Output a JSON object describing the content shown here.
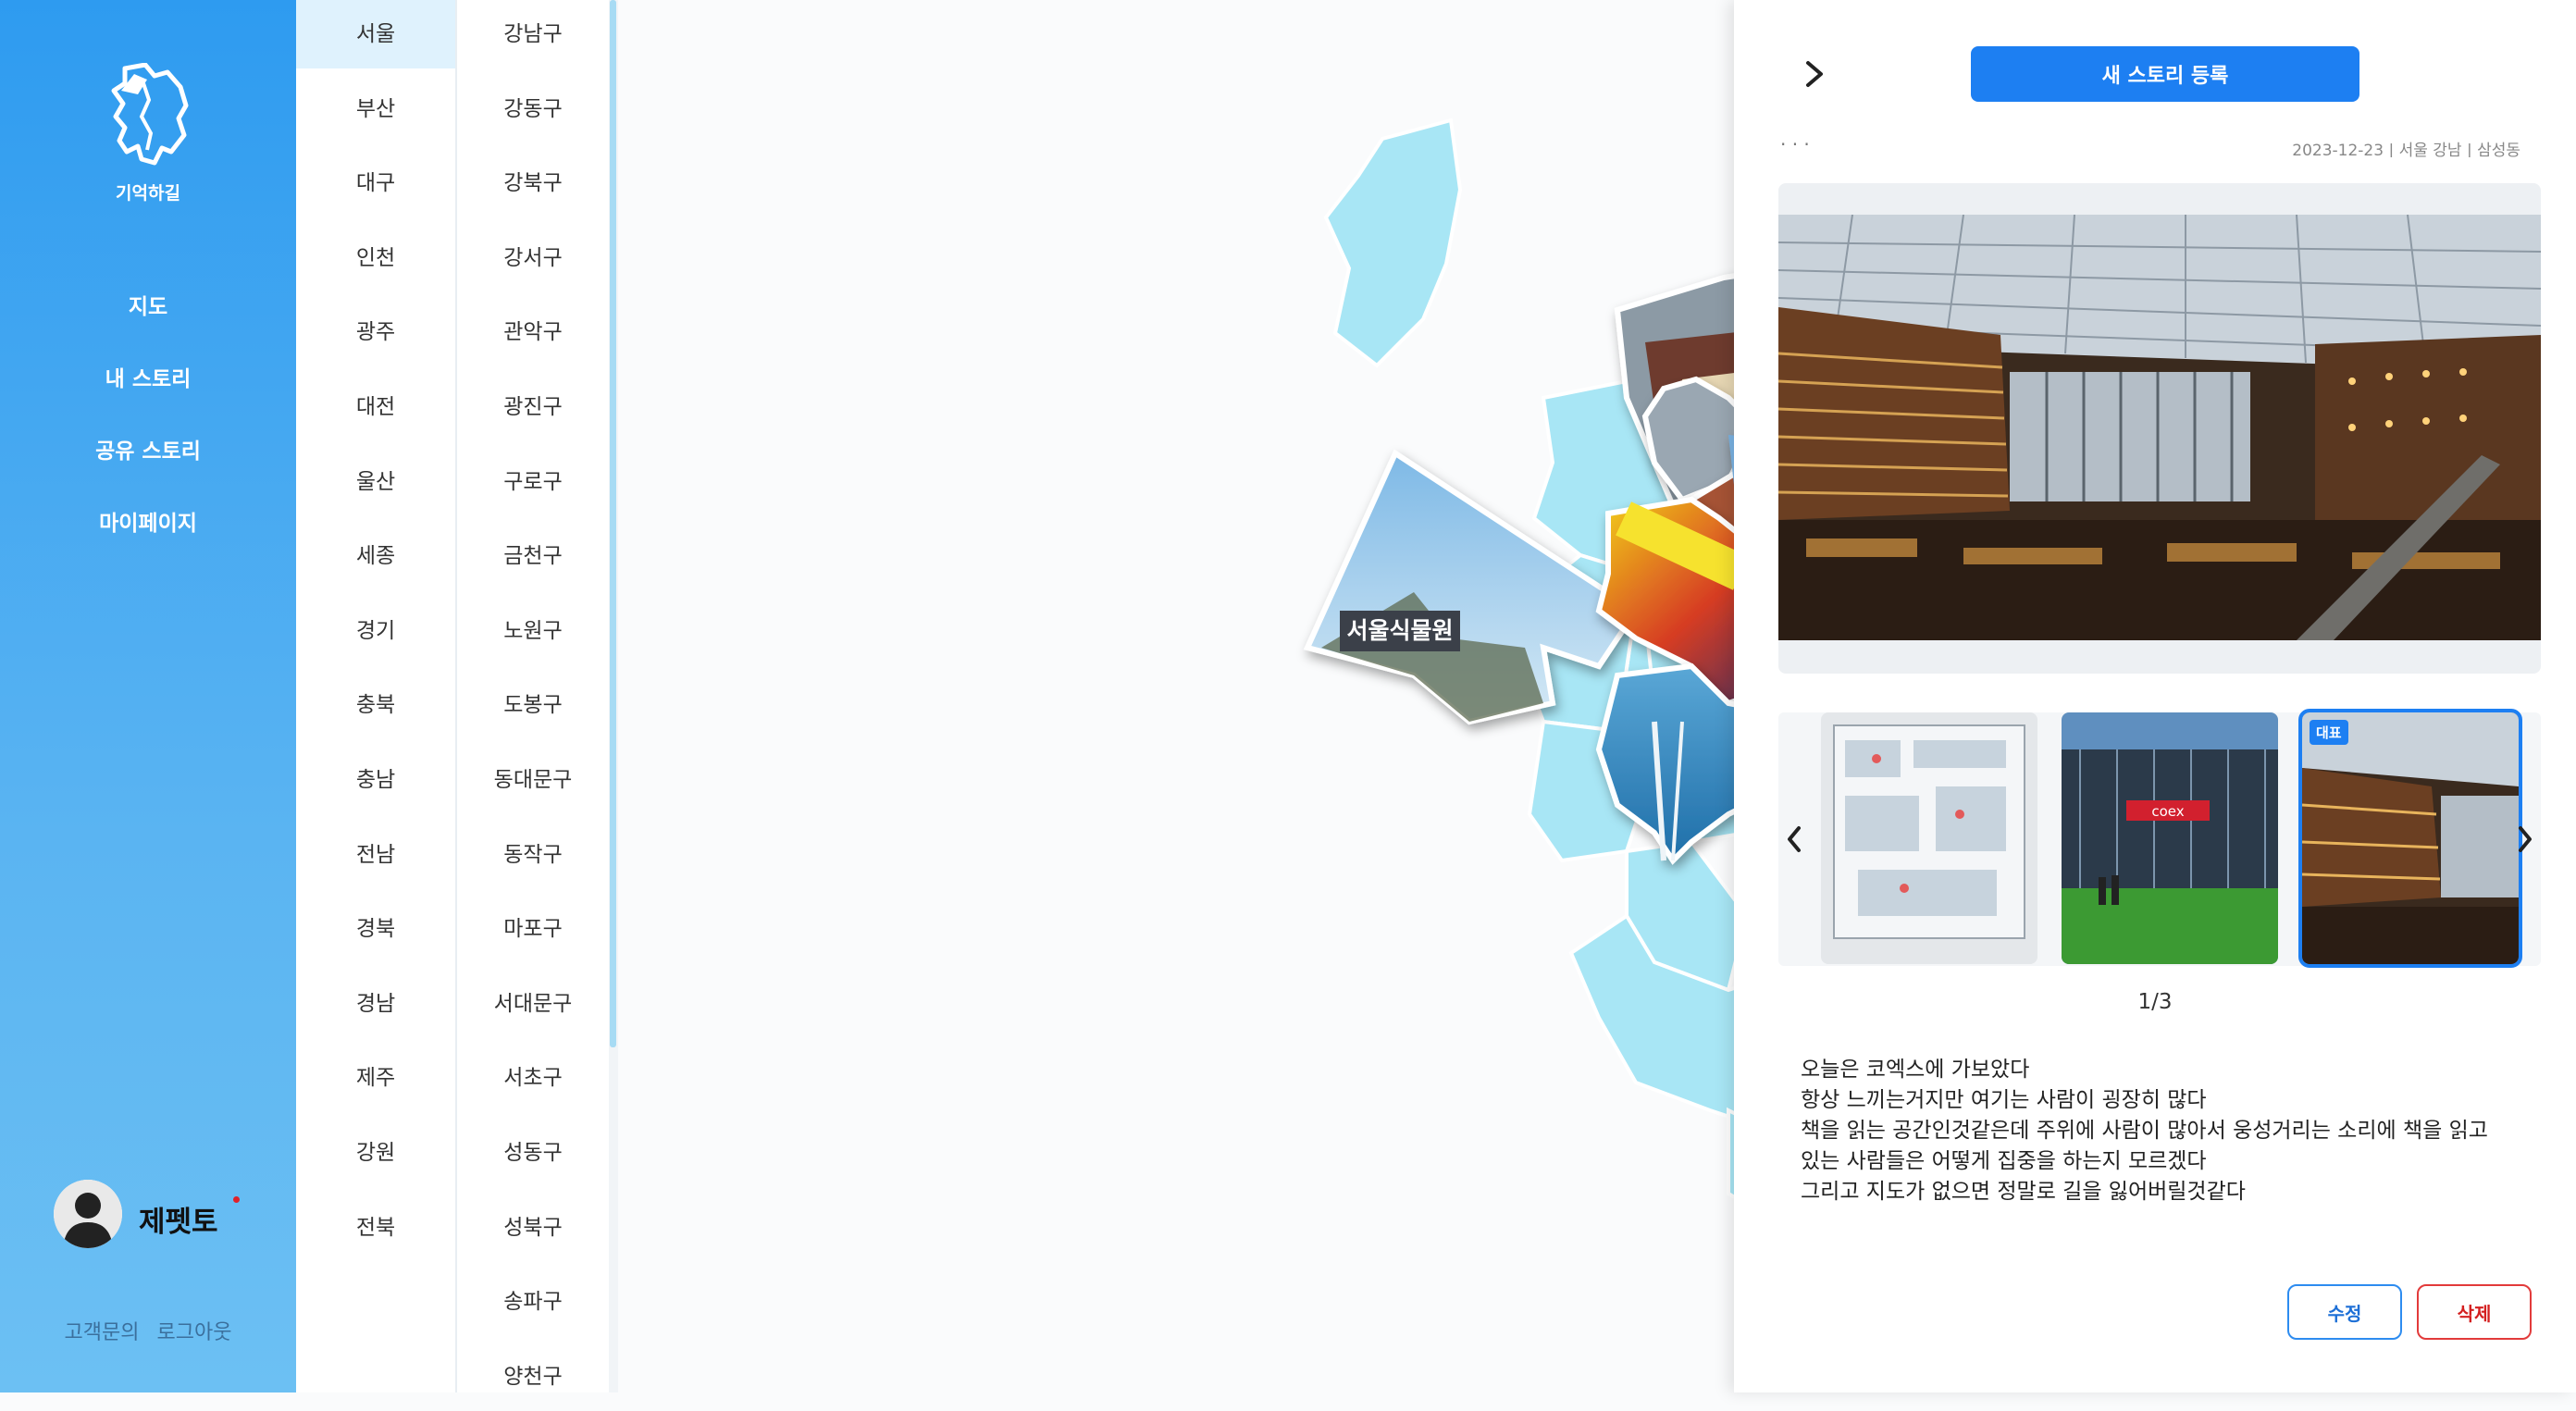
{
  "app": {
    "logo_text": "기억하길"
  },
  "nav": {
    "items": [
      {
        "label": "지도"
      },
      {
        "label": "내 스토리"
      },
      {
        "label": "공유 스토리"
      },
      {
        "label": "마이페이지"
      }
    ]
  },
  "user": {
    "name": "제펫토"
  },
  "footer": {
    "support": "고객문의",
    "logout": "로그아웃"
  },
  "provinces": [
    "서울",
    "부산",
    "대구",
    "인천",
    "광주",
    "대전",
    "울산",
    "세종",
    "경기",
    "충북",
    "충남",
    "전남",
    "경북",
    "경남",
    "제주",
    "강원",
    "전북"
  ],
  "selected_province": "서울",
  "districts": [
    "강남구",
    "강동구",
    "강북구",
    "강서구",
    "관악구",
    "광진구",
    "구로구",
    "금천구",
    "노원구",
    "도봉구",
    "동대문구",
    "동작구",
    "마포구",
    "서대문구",
    "서초구",
    "성동구",
    "성북구",
    "송파구",
    "양천구"
  ],
  "map": {
    "highlight_color": "#a8e6f5",
    "sign_label": "서울식물원"
  },
  "detail": {
    "new_story_label": "새 스토리 등록",
    "meta_author": "· · ·",
    "meta_info": "2023-12-23 | 서울 강남 | 삼성동",
    "representative_badge": "대표",
    "page_indicator": "1/3",
    "story_lines": [
      "오늘은 코엑스에 가보았다",
      "항상 느끼는거지만 여기는 사람이 굉장히 많다",
      "책을 읽는 공간인것같은데 주위에 사람이 많아서 웅성거리는 소리에 책을 읽고",
      "있는 사람들은 어떻게 집중을 하는지 모르겠다",
      "그리고 지도가 없으면 정말로 길을 잃어버릴것같다"
    ],
    "edit_label": "수정",
    "delete_label": "삭제",
    "thumb_sign": "coex"
  },
  "colors": {
    "accent": "#1d7ff2",
    "sidebar": "#3ba4f1",
    "delete": "#e23b3b"
  }
}
